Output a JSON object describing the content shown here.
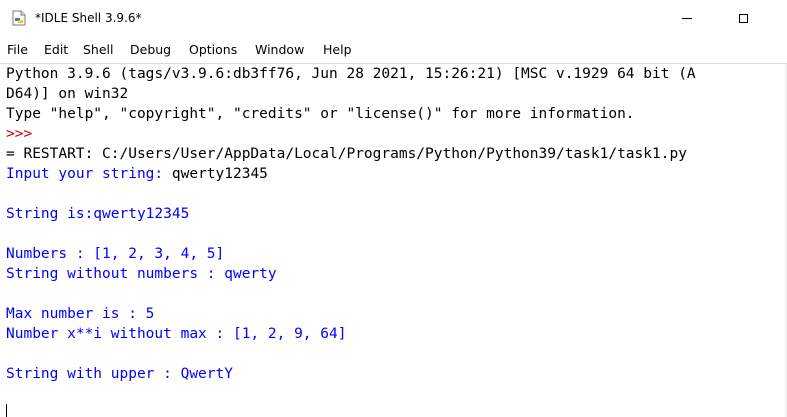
{
  "window": {
    "title": "*IDLE Shell 3.9.6*",
    "icon": "idle-python-feather-icon"
  },
  "menu": [
    "File",
    "Edit",
    "Shell",
    "Debug",
    "Options",
    "Window",
    "Help"
  ],
  "shell": {
    "banner": [
      "Python 3.9.6 (tags/v3.9.6:db3ff76, Jun 28 2021, 15:26:21) [MSC v.1929 64 bit (A",
      "D64)] on win32",
      "Type \"help\", \"copyright\", \"credits\" or \"license()\" for more information."
    ],
    "prompt": ">>>",
    "restart": "= RESTART: C:/Users/User/AppData/Local/Programs/Python/Python39/task1/task1.py",
    "input_prompt": "Input your string: ",
    "input_value": "qwerty12345",
    "output": [
      "String is:qwerty12345",
      "Numbers : [1, 2, 3, 4, 5]",
      "String without numbers : qwerty",
      "Max number is : 5",
      "Number x**i without max : [1, 2, 9, 64]",
      "String with upper : QwertY"
    ]
  },
  "colors": {
    "stdout": "#0000ff",
    "prompt": "#c00000",
    "text": "#000000"
  }
}
